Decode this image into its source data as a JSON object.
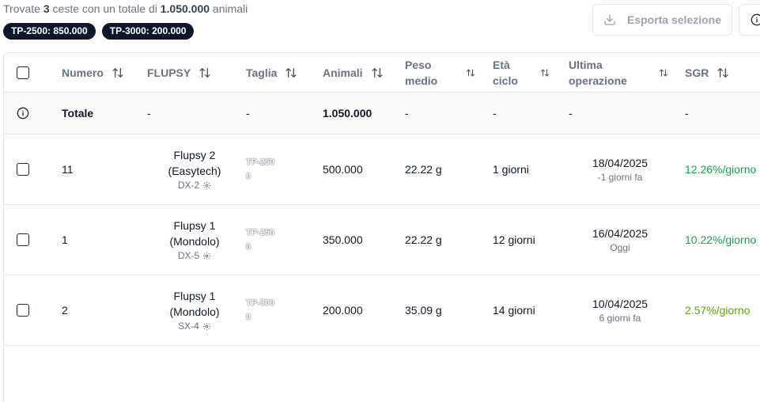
{
  "summary": {
    "prefix": "Trovate ",
    "count": "3",
    "middle": " ceste con un totale di ",
    "total": "1.050.000",
    "suffix": " animali"
  },
  "badges": [
    "TP-2500: 850.000",
    "TP-3000: 200.000"
  ],
  "toolbar": {
    "export_label": "Esporta selezione",
    "export_icon": "download-icon",
    "info_icon": "info-icon"
  },
  "table": {
    "columns": [
      {
        "line1": "Numero",
        "line2": ""
      },
      {
        "line1": "FLUPSY",
        "line2": ""
      },
      {
        "line1": "Taglia",
        "line2": ""
      },
      {
        "line1": "Animali",
        "line2": ""
      },
      {
        "line1": "Peso",
        "line2": "medio"
      },
      {
        "line1": "Età",
        "line2": "ciclo"
      },
      {
        "line1": "Ultima",
        "line2": "operazione"
      },
      {
        "line1": "SGR",
        "line2": ""
      }
    ],
    "totals": {
      "label": "Totale",
      "flupsy": "-",
      "taglia": "-",
      "animali": "1.050.000",
      "peso": "-",
      "eta": "-",
      "ultima": "-",
      "sgr": "-"
    },
    "rows": [
      {
        "numero": "11",
        "flupsy1": "Flupsy 2",
        "flupsy2": "(Easytech)",
        "position": "DX-2",
        "taglia": "TP-2500",
        "animali": "500.000",
        "peso": "22.22 g",
        "eta": "1 giorni",
        "data": "18/04/2025",
        "relativo": "-1 giorni fa",
        "sgr": "12.26%/giorno"
      },
      {
        "numero": "1",
        "flupsy1": "Flupsy 1",
        "flupsy2": "(Mondolo)",
        "position": "DX-5",
        "taglia": "TP-2500",
        "animali": "350.000",
        "peso": "22.22 g",
        "eta": "12 giorni",
        "data": "16/04/2025",
        "relativo": "Oggi",
        "sgr": "10.22%/giorno"
      },
      {
        "numero": "2",
        "flupsy1": "Flupsy 1",
        "flupsy2": "(Mondolo)",
        "position": "SX-4",
        "taglia": "TP-3000",
        "animali": "200.000",
        "peso": "35.09 g",
        "eta": "14 giorni",
        "data": "10/04/2025",
        "relativo": "6 giorni fa",
        "sgr": "2.57%/giorno"
      }
    ]
  },
  "colors": {
    "sgr_high": "#16a34a",
    "sgr_low": "#65a30d",
    "badge_bg": "#0f172a"
  }
}
